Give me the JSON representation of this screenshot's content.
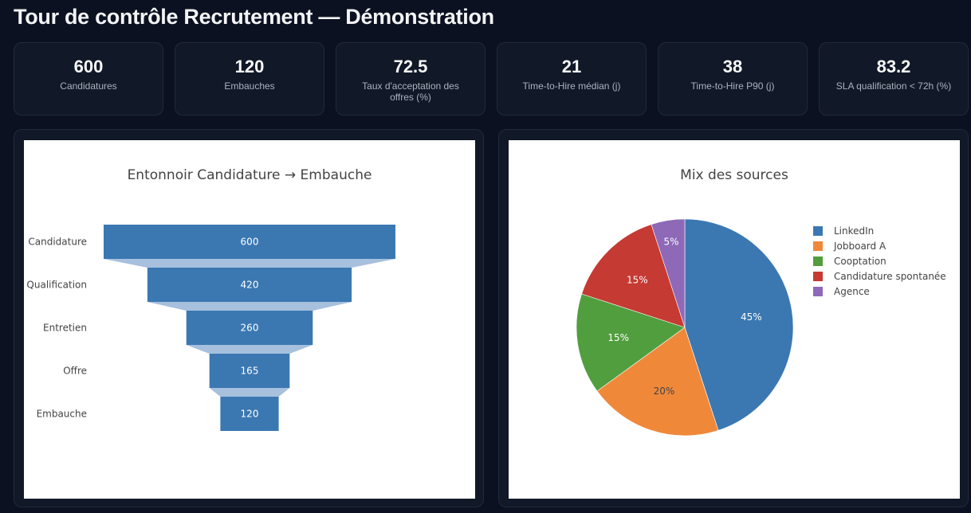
{
  "header": {
    "title": "Tour de contrôle Recrutement — Démonstration"
  },
  "kpis": [
    {
      "value": "600",
      "label": "Candidatures"
    },
    {
      "value": "120",
      "label": "Embauches"
    },
    {
      "value": "72.5",
      "label": "Taux d'acceptation des offres (%)"
    },
    {
      "value": "21",
      "label": "Time-to-Hire médian (j)"
    },
    {
      "value": "38",
      "label": "Time-to-Hire P90 (j)"
    },
    {
      "value": "83.2",
      "label": "SLA qualification < 72h (%)"
    }
  ],
  "chart_data": [
    {
      "type": "funnel",
      "title": "Entonnoir Candidature → Embauche",
      "categories": [
        "Candidature",
        "Qualification",
        "Entretien",
        "Offre",
        "Embauche"
      ],
      "values": [
        600,
        420,
        260,
        165,
        120
      ],
      "color": "#3b78b2",
      "connector_color": "#a6c0dd"
    },
    {
      "type": "pie",
      "title": "Mix des sources",
      "labels": [
        "LinkedIn",
        "Jobboard A",
        "Cooptation",
        "Candidature spontanée",
        "Agence"
      ],
      "values": [
        45,
        20,
        15,
        15,
        5
      ],
      "slice_labels": [
        "45%",
        "20%",
        "15%",
        "15%",
        "5%"
      ],
      "colors": [
        "#3b78b2",
        "#f0883a",
        "#519e3e",
        "#c53a32",
        "#8d69b8"
      ],
      "legend": "right"
    }
  ]
}
